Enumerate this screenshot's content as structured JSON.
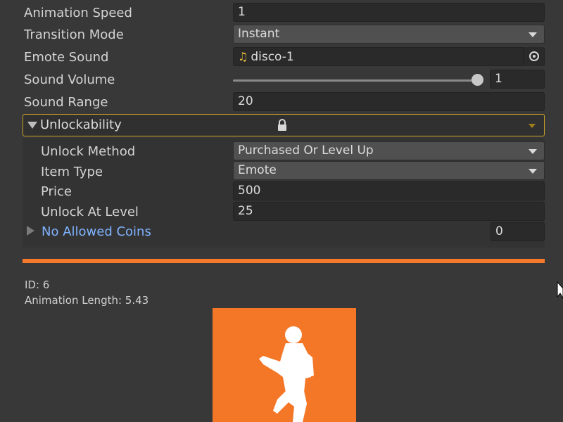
{
  "fields": {
    "animation_speed": {
      "label": "Animation Speed",
      "value": "1"
    },
    "transition_mode": {
      "label": "Transition Mode",
      "value": "Instant"
    },
    "emote_sound": {
      "label": "Emote Sound",
      "value": "disco-1"
    },
    "sound_volume": {
      "label": "Sound Volume",
      "value": "1",
      "slider_fraction": 0.97
    },
    "sound_range": {
      "label": "Sound Range",
      "value": "20"
    }
  },
  "unlockability": {
    "title": "Unlockability",
    "expanded": true,
    "locked": true,
    "unlock_method": {
      "label": "Unlock Method",
      "value": "Purchased Or Level Up"
    },
    "item_type": {
      "label": "Item Type",
      "value": "Emote"
    },
    "price": {
      "label": "Price",
      "value": "500"
    },
    "unlock_at_level": {
      "label": "Unlock At Level",
      "value": "25"
    },
    "no_allowed_coins": {
      "label": "No Allowed Coins",
      "count": "0"
    }
  },
  "info": {
    "id_text": "ID: 6",
    "animation_length_text": "Animation Length: 5.43"
  },
  "colors": {
    "accent_orange": "#f57a2b",
    "foldout_highlight": "#c9a227",
    "link_blue": "#7fb3ff"
  },
  "icons": {
    "emote_sound": "music-note-icon",
    "object_picker": "target-circle-icon",
    "lock": "lock-icon",
    "preview": "dancer-silhouette-icon"
  }
}
